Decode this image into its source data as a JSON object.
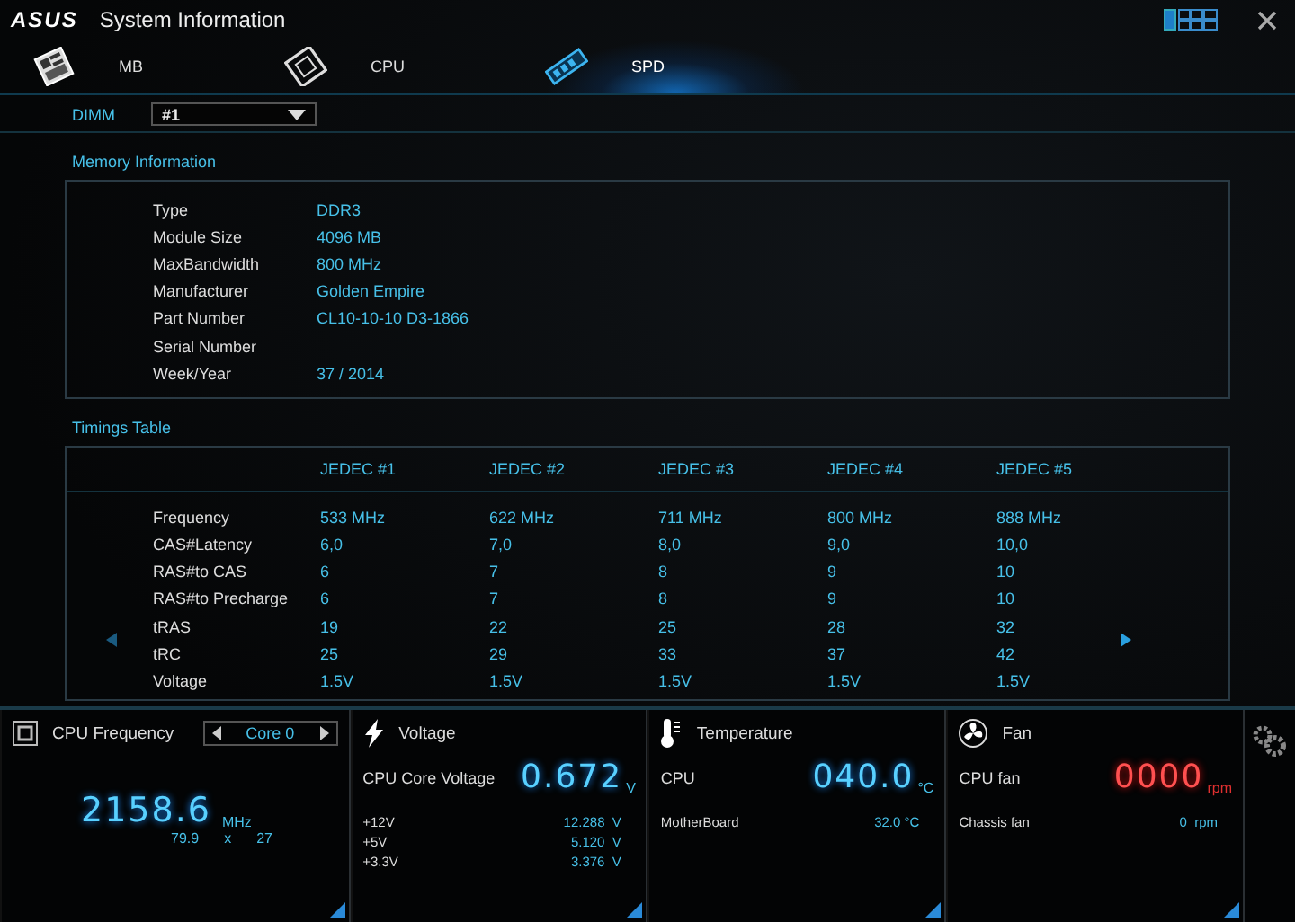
{
  "window": {
    "logo": "ASUS",
    "title": "System Information"
  },
  "tabs": [
    {
      "label": "MB",
      "kind": "board",
      "selected": false
    },
    {
      "label": "CPU",
      "kind": "chip",
      "selected": false
    },
    {
      "label": "SPD",
      "kind": "memory",
      "selected": true
    }
  ],
  "dimm": {
    "label": "DIMM",
    "value": "#1"
  },
  "memory_info": {
    "title": "Memory Information",
    "rows": [
      {
        "label": "Type",
        "value": "DDR3"
      },
      {
        "label": "Module Size",
        "value": "4096 MB"
      },
      {
        "label": "MaxBandwidth",
        "value": "800 MHz"
      },
      {
        "label": "Manufacturer",
        "value": "Golden Empire"
      },
      {
        "label": "Part Number",
        "value": "CL10-10-10 D3-1866"
      },
      {
        "label": "Serial Number"
      },
      {
        "label": "Week/Year",
        "value": "37 / 2014"
      }
    ]
  },
  "timings": {
    "title": "Timings Table",
    "columns": [
      "JEDEC #1",
      "JEDEC #2",
      "JEDEC #3",
      "JEDEC #4",
      "JEDEC #5"
    ],
    "rows": [
      {
        "label": "Frequency",
        "values": [
          "533 MHz",
          "622 MHz",
          "711 MHz",
          "800 MHz",
          "888 MHz"
        ]
      },
      {
        "label": "CAS#Latency",
        "values": [
          "6,0",
          "7,0",
          "8,0",
          "9,0",
          "10,0"
        ]
      },
      {
        "label": "RAS#to CAS",
        "values": [
          "6",
          "7",
          "8",
          "9",
          "10"
        ]
      },
      {
        "label": "RAS#to Precharge",
        "values": [
          "6",
          "7",
          "8",
          "9",
          "10"
        ]
      },
      {
        "label": "tRAS",
        "values": [
          "19",
          "22",
          "25",
          "28",
          "32"
        ]
      },
      {
        "label": "tRC",
        "values": [
          "25",
          "29",
          "33",
          "37",
          "42"
        ]
      },
      {
        "label": "Voltage",
        "values": [
          "1.5V",
          "1.5V",
          "1.5V",
          "1.5V",
          "1.5V"
        ]
      }
    ]
  },
  "cpu_frequency": {
    "title": "CPU Frequency",
    "core": "Core 0",
    "reading": "2158.6",
    "unit": "MHz",
    "bclk": "79.9",
    "times": "x",
    "multiplier": "27"
  },
  "panels": [
    {
      "kind": "voltage",
      "title": "Voltage",
      "main_label": "CPU Core Voltage",
      "main_reading": "0.672",
      "main_unit": "V",
      "alert": false,
      "rows": [
        {
          "label": "+12V",
          "value": "12.288  V"
        },
        {
          "label": "+5V",
          "value": "5.120  V"
        },
        {
          "label": "+3.3V",
          "value": "3.376  V"
        }
      ]
    },
    {
      "kind": "temperature",
      "title": "Temperature",
      "main_label": "CPU",
      "main_reading": "040.0",
      "main_unit": "°C",
      "alert": false,
      "rows": [
        {
          "label": "MotherBoard",
          "value": "32.0 °C"
        }
      ]
    },
    {
      "kind": "fan",
      "title": "Fan",
      "main_label": "CPU fan",
      "main_reading": "0000",
      "main_unit": "rpm",
      "alert": true,
      "rows": [
        {
          "label": "Chassis fan",
          "value": "0  rpm"
        }
      ]
    }
  ]
}
